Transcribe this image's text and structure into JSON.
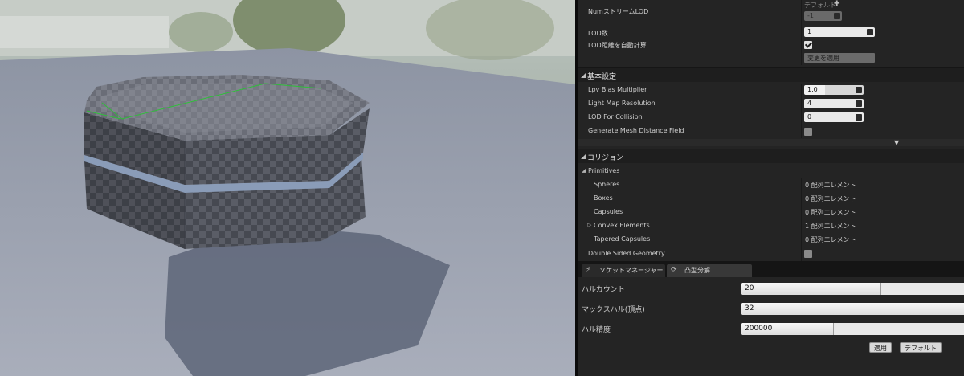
{
  "lod": {
    "num_stream_lod_label": "NumストリームLOD",
    "default_label": "デフォルト",
    "add_icon": "plus-icon",
    "num_stream_lod_value": "-1",
    "lod_count_label": "LOD数",
    "lod_count_value": "1",
    "auto_compute_label": "LOD距離を自動計算",
    "auto_compute_checked": true,
    "apply_changes_label": "変更を適用"
  },
  "basic_settings": {
    "title": "基本設定",
    "lpv_bias_label": "Lpv Bias Multiplier",
    "lpv_bias_value": "1.0",
    "lightmap_res_label": "Light Map Resolution",
    "lightmap_res_value": "4",
    "lod_collision_label": "LOD For Collision",
    "lod_collision_value": "0",
    "gen_distance_field_label": "Generate Mesh Distance Field",
    "gen_distance_field_checked": false
  },
  "collision": {
    "title": "コリジョン",
    "primitives_label": "Primitives",
    "items": [
      {
        "label": "Spheres",
        "value": "0 配列エレメント",
        "expandable": false
      },
      {
        "label": "Boxes",
        "value": "0 配列エレメント",
        "expandable": false
      },
      {
        "label": "Capsules",
        "value": "0 配列エレメント",
        "expandable": false
      },
      {
        "label": "Convex Elements",
        "value": "1 配列エレメント",
        "expandable": true
      },
      {
        "label": "Tapered Capsules",
        "value": "0 配列エレメント",
        "expandable": false
      }
    ],
    "double_sided_label": "Double Sided Geometry",
    "double_sided_checked": false
  },
  "tabs": [
    {
      "label": "ソケットマネージャー",
      "icon": "socket-icon",
      "active": false
    },
    {
      "label": "凸型分解",
      "icon": "convex-icon",
      "active": true
    }
  ],
  "convex": {
    "hull_count_label": "ハルカウント",
    "hull_count_value": "20",
    "hull_count_fraction": 0.62,
    "max_hull_verts_label": "マックスハル(頂点)",
    "max_hull_verts_value": "32",
    "max_hull_verts_fraction": 1.0,
    "hull_precision_label": "ハル精度",
    "hull_precision_value": "200000",
    "hull_precision_fraction": 0.41,
    "apply_label": "適用",
    "default_label": "デフォルト"
  }
}
